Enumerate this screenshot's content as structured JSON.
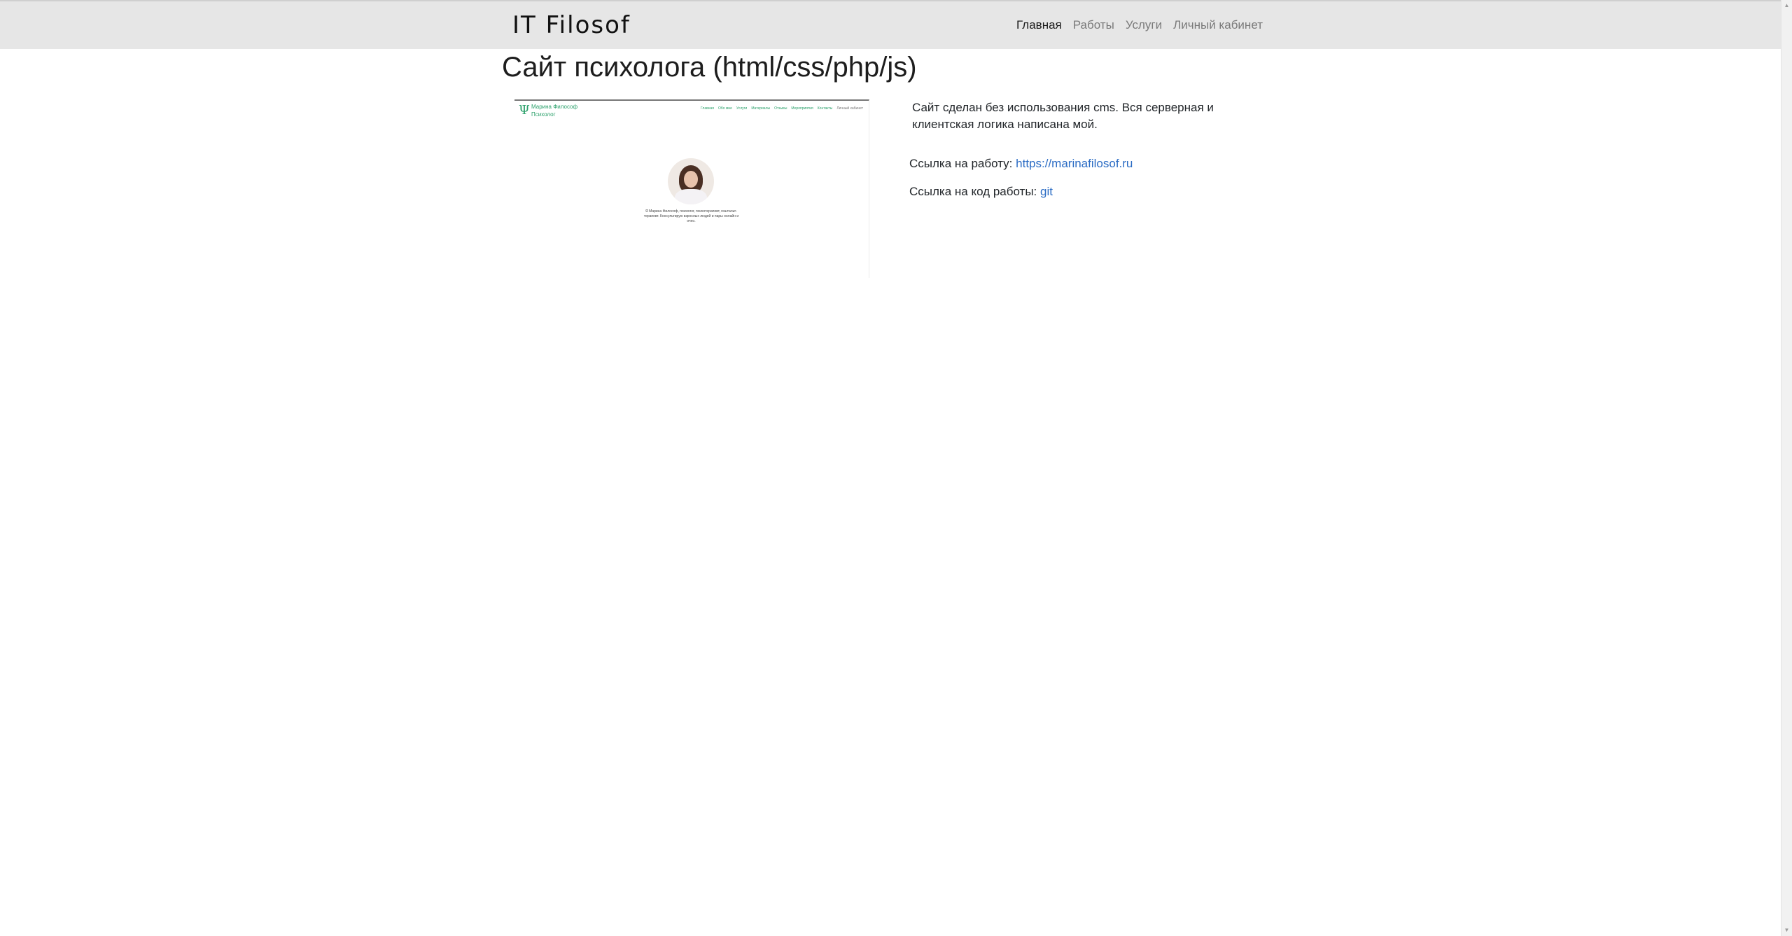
{
  "navbar": {
    "brand": "IT Filosof",
    "items": [
      {
        "label": "Главная",
        "active": true
      },
      {
        "label": "Работы",
        "active": false
      },
      {
        "label": "Услуги",
        "active": false
      },
      {
        "label": "Личный кабинет",
        "active": false
      }
    ]
  },
  "page": {
    "title": "Сайт психолога (html/css/php/js)",
    "description": "Сайт сделан без использования cms. Вся серверная и клиентская логика написана мой.",
    "work_link_label": "Ссылка на работу:",
    "work_link_text": "https://marinafilosof.ru",
    "code_link_label": "Ссылка на код работы:",
    "code_link_text": "git"
  },
  "preview": {
    "logo_symbol": "Ψ",
    "site_name": "Марина Философ Психолог",
    "menu": [
      "Главная",
      "Обо мне",
      "Услуги",
      "Материалы",
      "Отзывы",
      "Мероприятия",
      "Контакты",
      "Личный кабинет"
    ],
    "caption": "Я Марина Философ, психолог, психотерапевт, гештальт-терапевт. Консультирую взрослых людей и пары онлайн и очно."
  },
  "colors": {
    "navbar_bg": "#e6e6e6",
    "link": "#2b6cc4",
    "preview_accent": "#2aa06a"
  },
  "icons": {
    "scroll_up": "▲",
    "scroll_down": "▼"
  }
}
